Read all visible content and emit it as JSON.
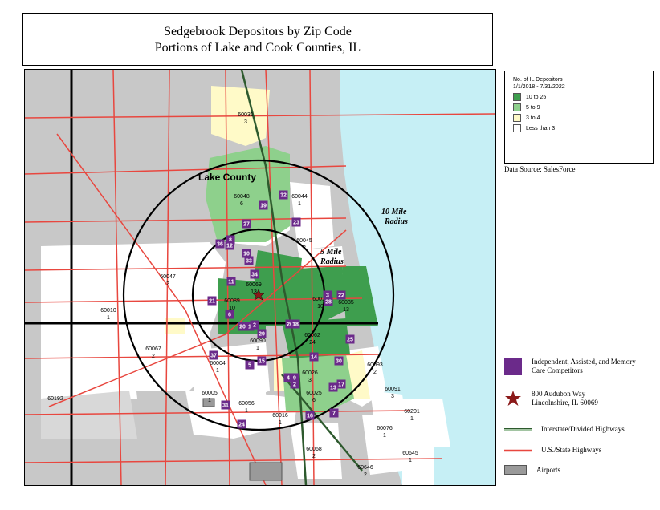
{
  "title": {
    "line1": "Sedgebrook Depositors by Zip Code",
    "line2": "Portions of Lake and Cook Counties, IL"
  },
  "legend": {
    "title_line1": "No. of IL Depositors",
    "title_line2": "1/1/2018 - 7/31/2022",
    "classes": [
      {
        "label": "10 to 25",
        "color": "#3e9e4e"
      },
      {
        "label": "5 to  9",
        "color": "#8ed08c"
      },
      {
        "label": "3 to  4",
        "color": "#fffac8"
      },
      {
        "label": "Less than 3",
        "color": "#ffffff"
      }
    ]
  },
  "data_source": "Data Source: SalesForce",
  "legend2": {
    "competitors": "Independent, Assisted, and Memory Care Competitors",
    "address_line1": "800 Audubon Way",
    "address_line2": "Lincolnshire, IL 60069",
    "interstate": "Interstate/Divided Highways",
    "us_state": "U.S./State Highways",
    "airports": "Airports"
  },
  "colors": {
    "water": "#c6eff5",
    "land_gray": "#c8c8c8",
    "dark_green": "#3e9e4e",
    "light_green": "#8ed08c",
    "pale_yellow": "#fffac8",
    "road_red": "#e8473f",
    "competitor": "#6b2a8a",
    "star": "#8b1a1a"
  },
  "map": {
    "county_label": "Lake County",
    "radius_10": "10 Mile Radius",
    "radius_10_l1": "10 Mile",
    "radius_10_l2": "Radius",
    "radius_5_l1": "5 Mile",
    "radius_5_l2": "Radius",
    "zips": [
      {
        "zip": "60031",
        "count": "3"
      },
      {
        "zip": "60048",
        "count": "6"
      },
      {
        "zip": "60044",
        "count": "1"
      },
      {
        "zip": "60045",
        "count": "2"
      },
      {
        "zip": "60047",
        "count": "2"
      },
      {
        "zip": "60069",
        "count": "13"
      },
      {
        "zip": "60089",
        "count": "10"
      },
      {
        "zip": "60015",
        "count": "10"
      },
      {
        "zip": "60035",
        "count": "13"
      },
      {
        "zip": "60010",
        "count": "1"
      },
      {
        "zip": "60090",
        "count": "1"
      },
      {
        "zip": "60062",
        "count": "24"
      },
      {
        "zip": "60067",
        "count": "2"
      },
      {
        "zip": "60004",
        "count": "1"
      },
      {
        "zip": "60093",
        "count": "2"
      },
      {
        "zip": "60026",
        "count": "3"
      },
      {
        "zip": "60025",
        "count": "6"
      },
      {
        "zip": "60091",
        "count": "3"
      },
      {
        "zip": "60005",
        "count": "1"
      },
      {
        "zip": "60056",
        "count": "1"
      },
      {
        "zip": "60192",
        "count": ""
      },
      {
        "zip": "60016",
        "count": "1"
      },
      {
        "zip": "60201",
        "count": "1"
      },
      {
        "zip": "60076",
        "count": "1"
      },
      {
        "zip": "60068",
        "count": "2"
      },
      {
        "zip": "60645",
        "count": "1"
      },
      {
        "zip": "60646",
        "count": "2"
      }
    ],
    "competitors": [
      "32",
      "19",
      "23",
      "27",
      "8",
      "36",
      "12",
      "10",
      "33",
      "34",
      "11",
      "21",
      "6",
      "20",
      "1",
      "2",
      "29",
      "26",
      "18",
      "3",
      "22",
      "28",
      "25",
      "37",
      "5",
      "15",
      "14",
      "30",
      "4",
      "9",
      "2",
      "13",
      "17",
      "31",
      "24",
      "16",
      "7"
    ]
  }
}
